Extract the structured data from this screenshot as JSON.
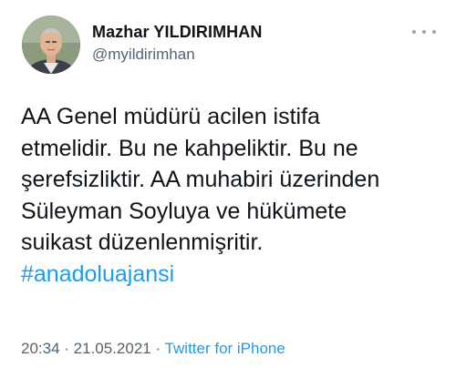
{
  "author": {
    "name": "Mazhar YILDIRIMHAN",
    "handle": "@myildirimhan"
  },
  "tweet": {
    "lines": [
      "AA Genel müdürü acilen istifa",
      "etmelidir. Bu ne kahpeliktir. Bu ne",
      "şerefsizliktir. AA muhabiri üzerinden",
      "Süleyman Soyluya ve hükümete",
      "suikast düzenlenmişritir."
    ],
    "hashtag": "#anadoluajansi"
  },
  "meta": {
    "time": "20:34",
    "separator_1": " · ",
    "date": "21.05.2021",
    "separator_2": " · ",
    "source": "Twitter for iPhone"
  },
  "colors": {
    "link": "#1d9bf0",
    "secondary_text": "#536471",
    "primary_text": "#0f1419"
  },
  "icons": {
    "more": "more-horizontal-icon"
  }
}
